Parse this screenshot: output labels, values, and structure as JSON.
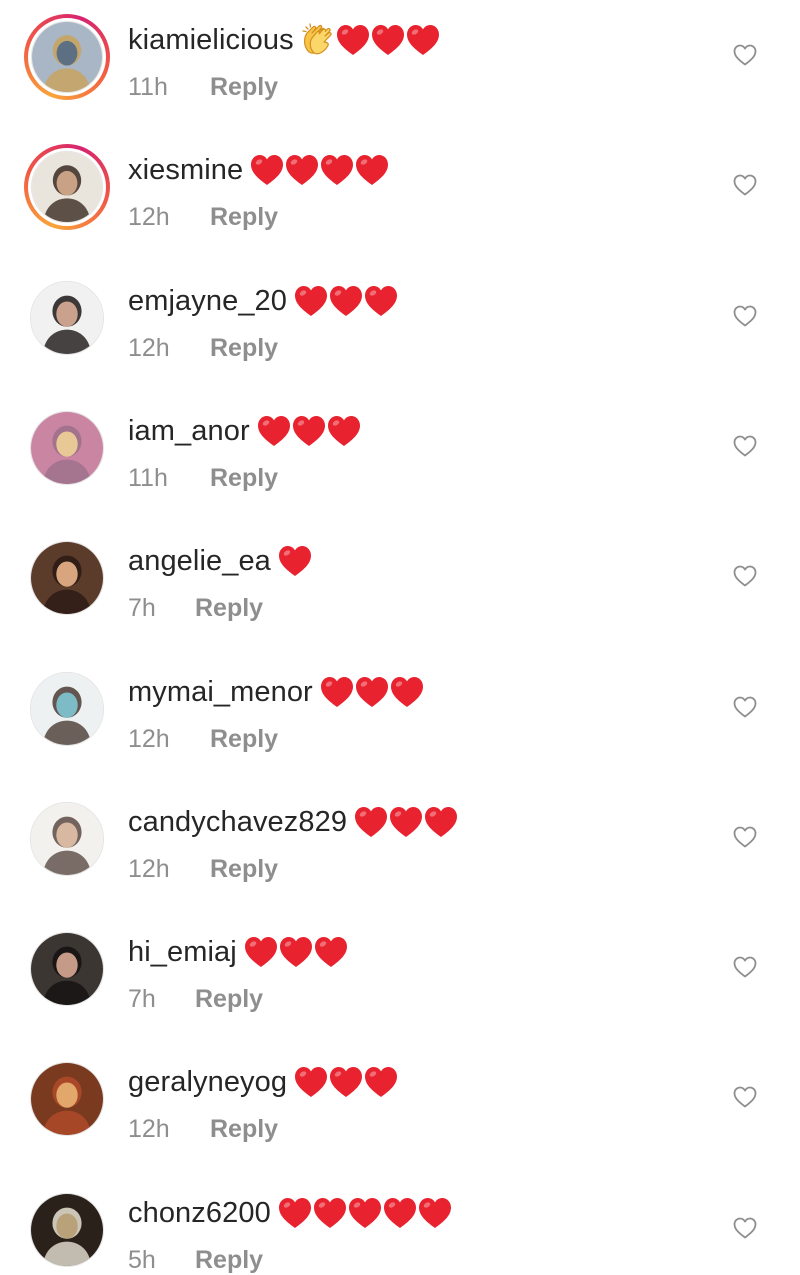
{
  "comments": [
    {
      "username": "kiamielicious",
      "time": "11h",
      "reply_label": "Reply",
      "emojis": [
        "clapping-hands",
        "red-heart",
        "red-heart",
        "red-heart"
      ],
      "story_ring": true,
      "avatar_colors": [
        "#a8b6c6",
        "#5d6f83",
        "#c9a35a"
      ]
    },
    {
      "username": "xiesmine",
      "time": "12h",
      "reply_label": "Reply",
      "emojis": [
        "red-heart",
        "red-heart",
        "red-heart",
        "red-heart"
      ],
      "story_ring": true,
      "avatar_colors": [
        "#e9e4dc",
        "#c9a184",
        "#3a2a22"
      ]
    },
    {
      "username": "emjayne_20",
      "time": "12h",
      "reply_label": "Reply",
      "emojis": [
        "red-heart",
        "red-heart",
        "red-heart"
      ],
      "story_ring": false,
      "avatar_colors": [
        "#f1f1f1",
        "#caa18c",
        "#1d1717"
      ]
    },
    {
      "username": "iam_anor",
      "time": "11h",
      "reply_label": "Reply",
      "emojis": [
        "red-heart",
        "red-heart",
        "red-heart"
      ],
      "story_ring": false,
      "avatar_colors": [
        "#c985a2",
        "#e8c995",
        "#9c6f8a"
      ]
    },
    {
      "username": "angelie_ea",
      "time": "7h",
      "reply_label": "Reply",
      "emojis": [
        "red-heart"
      ],
      "story_ring": false,
      "avatar_colors": [
        "#5b3b2a",
        "#d9a57e",
        "#2a1a14"
      ]
    },
    {
      "username": "mymai_menor",
      "time": "12h",
      "reply_label": "Reply",
      "emojis": [
        "red-heart",
        "red-heart",
        "red-heart"
      ],
      "story_ring": false,
      "avatar_colors": [
        "#eef1f1",
        "#7dbcc7",
        "#4a3b35"
      ]
    },
    {
      "username": "candychavez829",
      "time": "12h",
      "reply_label": "Reply",
      "emojis": [
        "red-heart",
        "red-heart",
        "red-heart"
      ],
      "story_ring": false,
      "avatar_colors": [
        "#f3f1ee",
        "#d8b8a1",
        "#5a4a44"
      ]
    },
    {
      "username": "hi_emiaj",
      "time": "7h",
      "reply_label": "Reply",
      "emojis": [
        "red-heart",
        "red-heart",
        "red-heart"
      ],
      "story_ring": false,
      "avatar_colors": [
        "#3c3633",
        "#c59a86",
        "#141110"
      ]
    },
    {
      "username": "geralyneyog",
      "time": "12h",
      "reply_label": "Reply",
      "emojis": [
        "red-heart",
        "red-heart",
        "red-heart"
      ],
      "story_ring": false,
      "avatar_colors": [
        "#7a3a1f",
        "#e2a76a",
        "#b24b2a"
      ]
    },
    {
      "username": "chonz6200",
      "time": "5h",
      "reply_label": "Reply",
      "emojis": [
        "red-heart",
        "red-heart",
        "red-heart",
        "red-heart",
        "red-heart"
      ],
      "story_ring": false,
      "avatar_colors": [
        "#2a211a",
        "#b9a27a",
        "#e8e2d4"
      ]
    }
  ],
  "colors": {
    "heart": "#e8222f",
    "secondary_text": "#8e8e8e",
    "primary_text": "#262626"
  }
}
